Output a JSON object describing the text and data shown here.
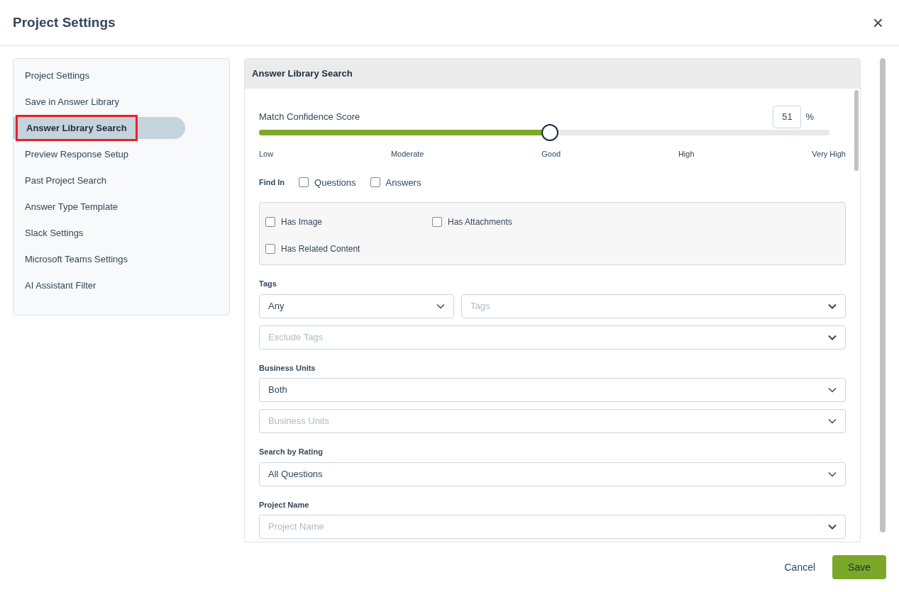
{
  "dialog": {
    "title": "Project Settings",
    "close": "×"
  },
  "sidebar": {
    "items": [
      {
        "label": "Project Settings",
        "selected": false
      },
      {
        "label": "Save in Answer Library",
        "selected": false
      },
      {
        "label": "Answer Library Search",
        "selected": true
      },
      {
        "label": "Preview Response Setup",
        "selected": false
      },
      {
        "label": "Past Project Search",
        "selected": false
      },
      {
        "label": "Answer Type Template",
        "selected": false
      },
      {
        "label": "Slack Settings",
        "selected": false
      },
      {
        "label": "Microsoft Teams Settings",
        "selected": false
      },
      {
        "label": "AI Assistant Filter",
        "selected": false
      }
    ]
  },
  "panel": {
    "title": "Answer Library Search",
    "score": {
      "label": "Match Confidence Score",
      "value": "51",
      "unit": "%",
      "level": 0.51,
      "ticks": [
        "Low",
        "Moderate",
        "Good",
        "High",
        "Very High"
      ]
    },
    "find_in": {
      "label": "Find In",
      "options": [
        {
          "label": "Questions",
          "checked": false
        },
        {
          "label": "Answers",
          "checked": false
        }
      ]
    },
    "content_filters": [
      {
        "label": "Has Image",
        "checked": false
      },
      {
        "label": "Has Attachments",
        "checked": false
      },
      {
        "label": "Has Related Content",
        "checked": false
      }
    ],
    "filters": [
      {
        "label": "Tags",
        "rows": [
          [
            {
              "kind": "select",
              "value": "Any"
            },
            {
              "kind": "multi",
              "placeholder": "Tags"
            }
          ],
          [
            {
              "kind": "multi",
              "placeholder": "Exclude Tags"
            }
          ]
        ]
      },
      {
        "label": "Business Units",
        "rows": [
          [
            {
              "kind": "select",
              "value": "Both"
            }
          ],
          [
            {
              "kind": "select",
              "placeholder": "Business Units"
            }
          ]
        ]
      },
      {
        "label": "Search by Rating",
        "rows": [
          [
            {
              "kind": "select",
              "value": "All Questions"
            }
          ]
        ]
      },
      {
        "label": "Project Name",
        "rows": [
          [
            {
              "kind": "multi",
              "placeholder": "Project Name"
            }
          ]
        ]
      }
    ]
  },
  "footer": {
    "buttons": [
      {
        "label": "Cancel",
        "kind": "link"
      },
      {
        "label": "Save",
        "kind": "primary"
      }
    ]
  }
}
